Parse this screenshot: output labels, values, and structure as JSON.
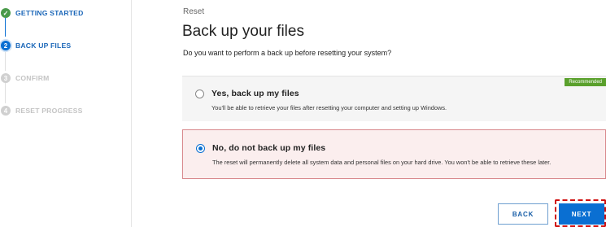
{
  "sidebar": {
    "steps": [
      {
        "label": "GETTING STARTED",
        "status": "done",
        "marker": "✓"
      },
      {
        "label": "BACK UP FILES",
        "status": "active",
        "marker": "2"
      },
      {
        "label": "CONFIRM",
        "status": "pending",
        "marker": "3"
      },
      {
        "label": "RESET PROGRESS",
        "status": "pending",
        "marker": "4"
      }
    ]
  },
  "main": {
    "breadcrumb": "Reset",
    "title": "Back up your files",
    "question": "Do you want to perform a back up before resetting your system?",
    "options": [
      {
        "title": "Yes, back up my files",
        "description": "You'll be able to retrieve your files after resetting your computer and setting up Windows.",
        "badge": "Recommended",
        "selected": false
      },
      {
        "title": "No, do not back up my files",
        "description": "The reset will permanently delete all system data and personal files on your hard drive. You won't be able to retrieve these later.",
        "selected": true
      }
    ]
  },
  "buttons": {
    "back": "BACK",
    "next": "NEXT"
  },
  "colors": {
    "accent": "#0a6fd2",
    "done": "#4a9a4a",
    "warning_bg": "#fbeeee",
    "warning_border": "#d8888c",
    "badge": "#5aa02c",
    "highlight": "#d01010"
  }
}
